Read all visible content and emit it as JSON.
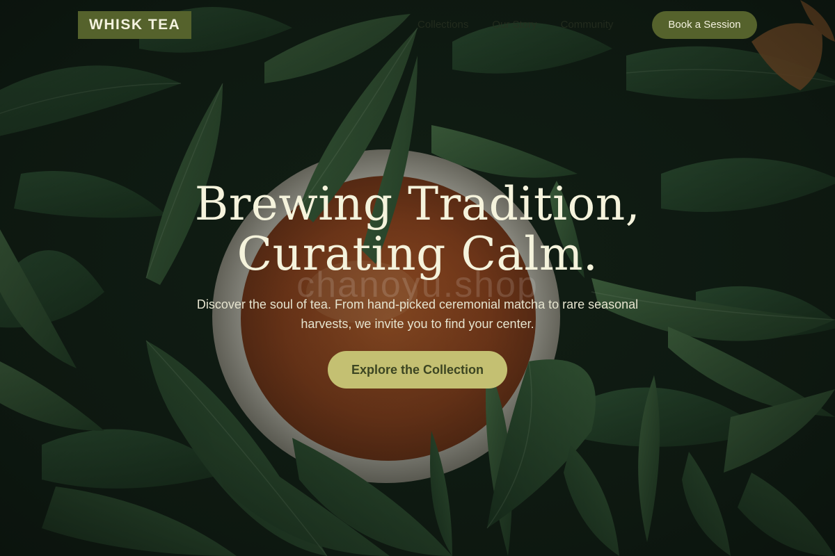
{
  "brand": {
    "name": "WHISK TEA"
  },
  "nav": {
    "links": [
      "Collections",
      "Our Story",
      "Community"
    ],
    "cta_label": "Book a Session"
  },
  "hero": {
    "headline_line1": "Brewing Tradition,",
    "headline_line2": "Curating Calm.",
    "watermark": "chanoyu.shop",
    "subtext": "Discover the soul of tea. From hand-picked ceremonial matcha to rare seasonal harvests, we invite you to find your center.",
    "cta_label": "Explore the Collection",
    "background_image": "leaves-with-tea-cup-photo"
  },
  "colors": {
    "brand_olive": "#55622c",
    "cta_gold": "#c4c072",
    "headline_cream": "#f5f3dc",
    "leaf_green": "#2f5a35"
  }
}
